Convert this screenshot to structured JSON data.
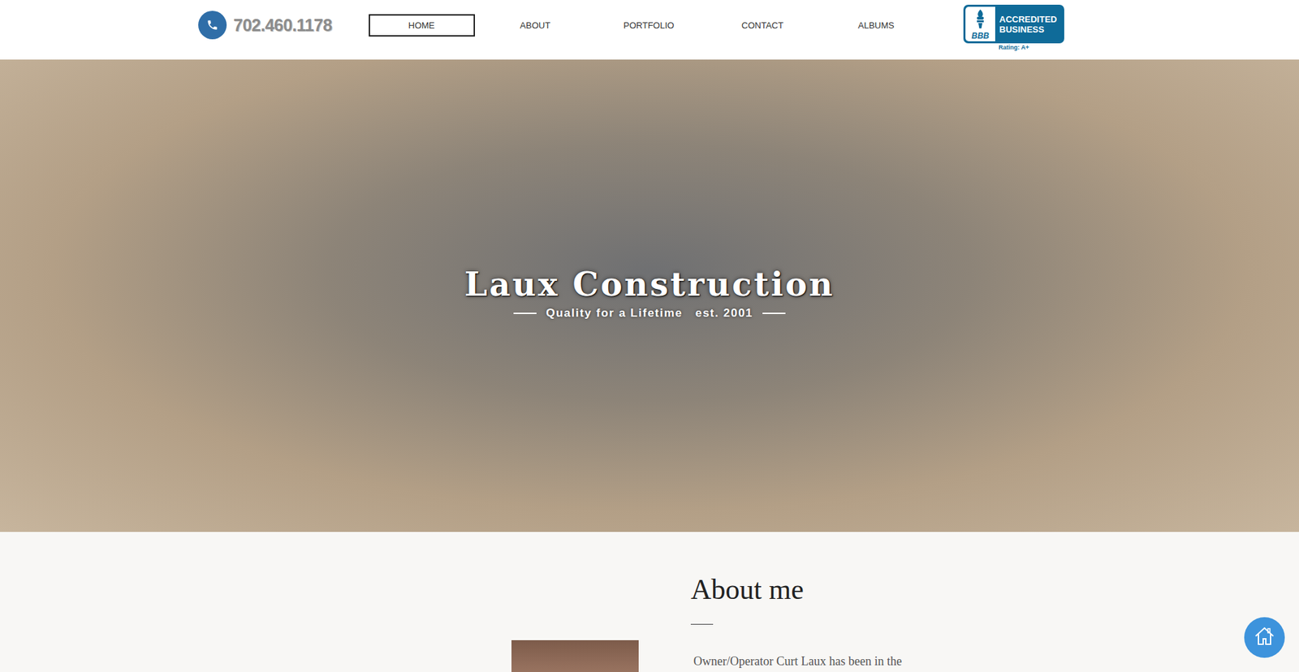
{
  "header": {
    "phone": "702.460.1178"
  },
  "nav": [
    {
      "label": "HOME",
      "selected": true
    },
    {
      "label": "ABOUT",
      "selected": false
    },
    {
      "label": "PORTFOLIO",
      "selected": false
    },
    {
      "label": "CONTACT",
      "selected": false
    },
    {
      "label": "ALBUMS",
      "selected": false
    }
  ],
  "bbb": {
    "mark": "BBB",
    "line1": "ACCREDITED",
    "line2": "BUSINESS",
    "rating": "Rating: A+"
  },
  "hero": {
    "title": "Laux Construction",
    "subtitle": "Quality for a Lifetime   est. 2001"
  },
  "about": {
    "heading": "About me",
    "text": "Owner/Operator Curt Laux has been in the"
  }
}
